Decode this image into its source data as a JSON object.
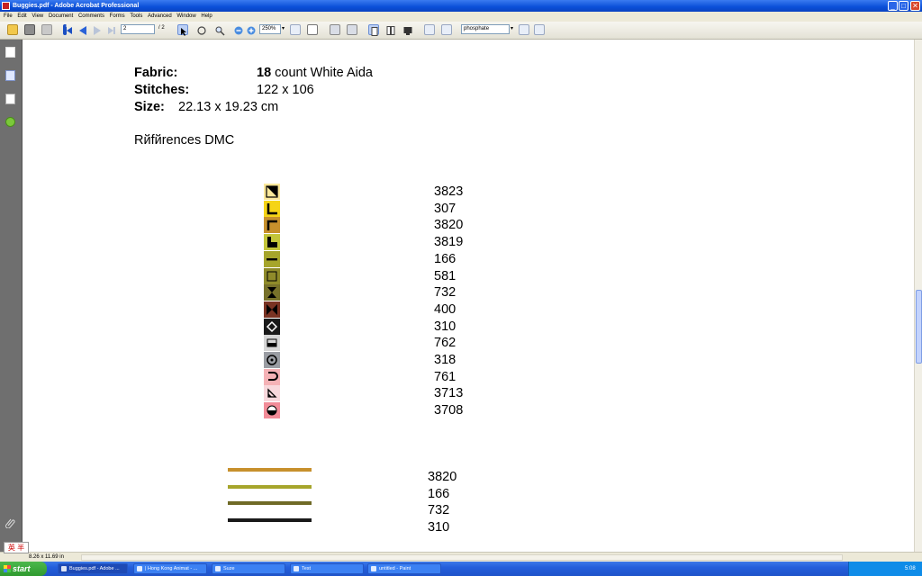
{
  "window": {
    "title": "Buggies.pdf - Adobe Acrobat Professional",
    "minimize": "_",
    "maximize": "□",
    "close": "✕"
  },
  "menu": [
    "File",
    "Edit",
    "View",
    "Document",
    "Comments",
    "Forms",
    "Tools",
    "Advanced",
    "Window",
    "Help"
  ],
  "toolbar": {
    "page_number": "2",
    "page_total": "/ 2",
    "zoom": "250%",
    "search_value": "phosphate"
  },
  "status": {
    "page_size": "8.26 x 11.69 in",
    "ime": "英 半"
  },
  "doc": {
    "fabric_label": "Fabric:",
    "fabric_count": "18",
    "fabric_value": " count White Aida",
    "stitches_label": "Stitches:",
    "stitches_value": "122 x 106",
    "size_label": "Size:",
    "size_value": "22.13 x 19.23 cm",
    "references": "Rйfйrences DMC"
  },
  "symbol_legend": [
    {
      "code": "3823",
      "color": "#fbe89a",
      "icon": "triangle-corner-icon"
    },
    {
      "code": "307",
      "color": "#f5d416",
      "icon": "l-shape-icon"
    },
    {
      "code": "3820",
      "color": "#c7902c",
      "icon": "corner-bracket-icon"
    },
    {
      "code": "3819",
      "color": "#c3c53a",
      "icon": "step-shape-icon"
    },
    {
      "code": "166",
      "color": "#a6a52b",
      "icon": "dash-icon"
    },
    {
      "code": "581",
      "color": "#8f8b2a",
      "icon": "square-outline-icon"
    },
    {
      "code": "732",
      "color": "#77712a",
      "icon": "hourglass-icon"
    },
    {
      "code": "400",
      "color": "#7a3323",
      "icon": "bowtie-icon"
    },
    {
      "code": "310",
      "color": "#1a1a1a",
      "icon": "diamond-icon"
    },
    {
      "code": "762",
      "color": "#d6d6d6",
      "icon": "half-rectangle-icon"
    },
    {
      "code": "318",
      "color": "#9a9da3",
      "icon": "circle-dot-icon"
    },
    {
      "code": "761",
      "color": "#f5b2b6",
      "icon": "u-curve-icon"
    },
    {
      "code": "3713",
      "color": "#f8d8dc",
      "icon": "small-triangle-icon"
    },
    {
      "code": "3708",
      "color": "#f28c98",
      "icon": "half-circle-icon"
    }
  ],
  "backstitch_legend": [
    {
      "code": "3820",
      "color": "#c7902c"
    },
    {
      "code": "166",
      "color": "#a6a52b"
    },
    {
      "code": "732",
      "color": "#6f6a26"
    },
    {
      "code": "310",
      "color": "#1a1a1a"
    }
  ],
  "taskbar": {
    "start": "start",
    "tasks": [
      "Buggies.pdf - Adobe ...",
      "| Hong Kong Animat - ...",
      "Suze",
      "Test",
      "untitled - Paint"
    ],
    "clock": "5:08"
  }
}
